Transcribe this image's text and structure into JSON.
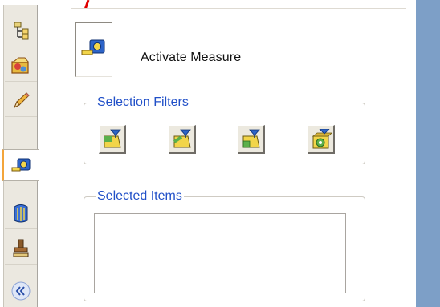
{
  "tabs": [
    {
      "name": "feature-tree",
      "icon": "feature-tree-icon",
      "active": false
    },
    {
      "name": "property-manager",
      "icon": "property-manager-icon",
      "active": false
    },
    {
      "name": "sketch",
      "icon": "pencil-icon",
      "active": false
    },
    {
      "name": "measure",
      "icon": "measure-tape-icon",
      "active": true
    },
    {
      "name": "section-properties",
      "icon": "section-properties-icon",
      "active": false
    },
    {
      "name": "stamp",
      "icon": "stamp-icon",
      "active": false
    },
    {
      "name": "collapse",
      "icon": "double-chevron-left-icon",
      "active": false
    }
  ],
  "panel": {
    "activate_label": "Activate Measure",
    "selection_filters": {
      "title": "Selection Filters",
      "buttons": [
        {
          "name": "filter-face",
          "icon": "face-filter-icon"
        },
        {
          "name": "filter-edge",
          "icon": "edge-filter-icon"
        },
        {
          "name": "filter-vertex",
          "icon": "vertex-filter-icon"
        },
        {
          "name": "filter-hole",
          "icon": "hole-filter-icon"
        }
      ]
    },
    "selected_items": {
      "title": "Selected Items",
      "items": []
    }
  },
  "colors": {
    "accent_tab": "#f3a53b",
    "group_title": "#2150c8",
    "right_background": "#7d9fc7",
    "annotation_arrow": "#e00000"
  }
}
